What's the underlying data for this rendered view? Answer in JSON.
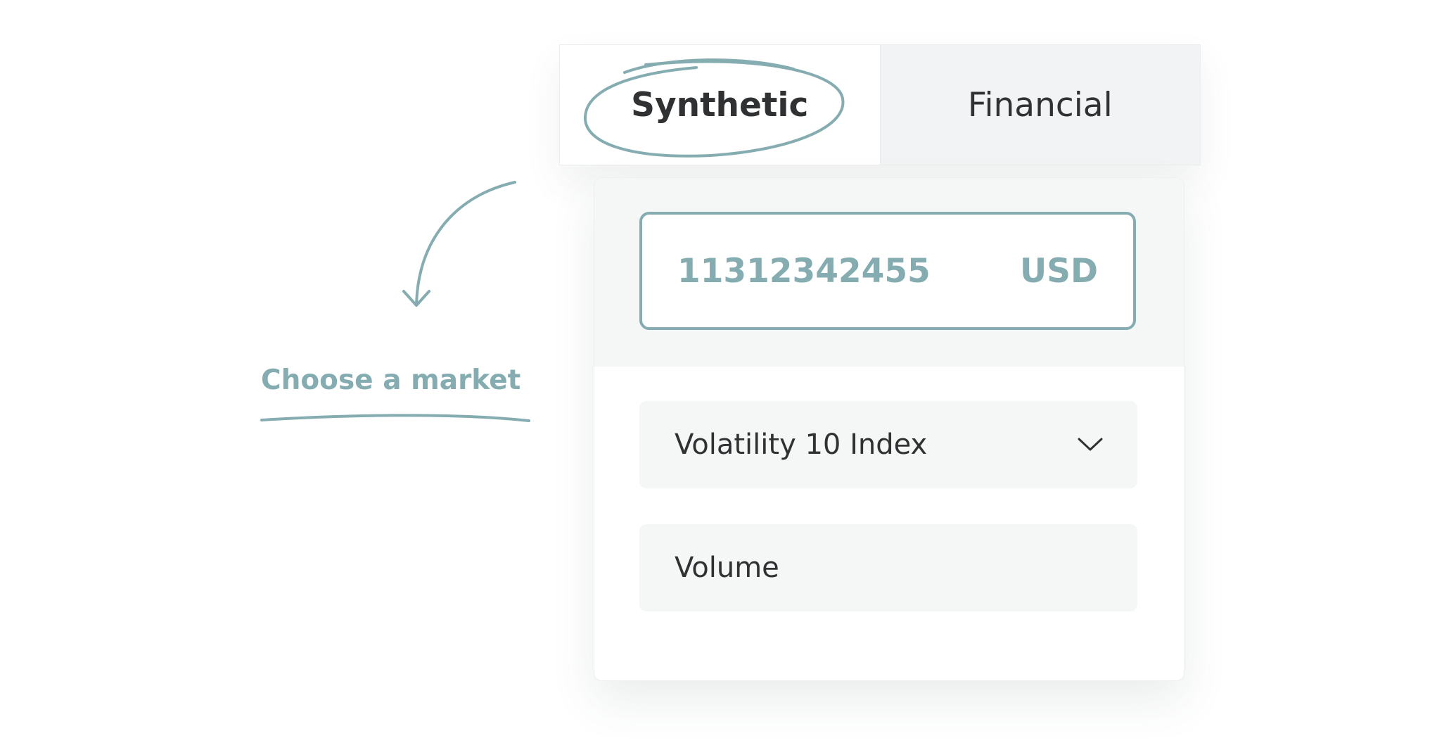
{
  "tabs": {
    "synthetic": "Synthetic",
    "financial": "Financial",
    "active": "Synthetic"
  },
  "account": {
    "number": "11312342455",
    "currency": "USD"
  },
  "market_select": {
    "value": "Volatility 10 Index"
  },
  "volume_field": {
    "label": "Volume"
  },
  "annotation": {
    "text": "Choose a market"
  },
  "colors": {
    "accent": "#85acb0",
    "text": "#2f3133",
    "panel_bg": "#f5f6f6",
    "inactive_tab_bg": "#f2f3f4"
  },
  "icons": {
    "dropdown": "chevron-down-icon",
    "pointer": "curved-arrow-icon"
  }
}
